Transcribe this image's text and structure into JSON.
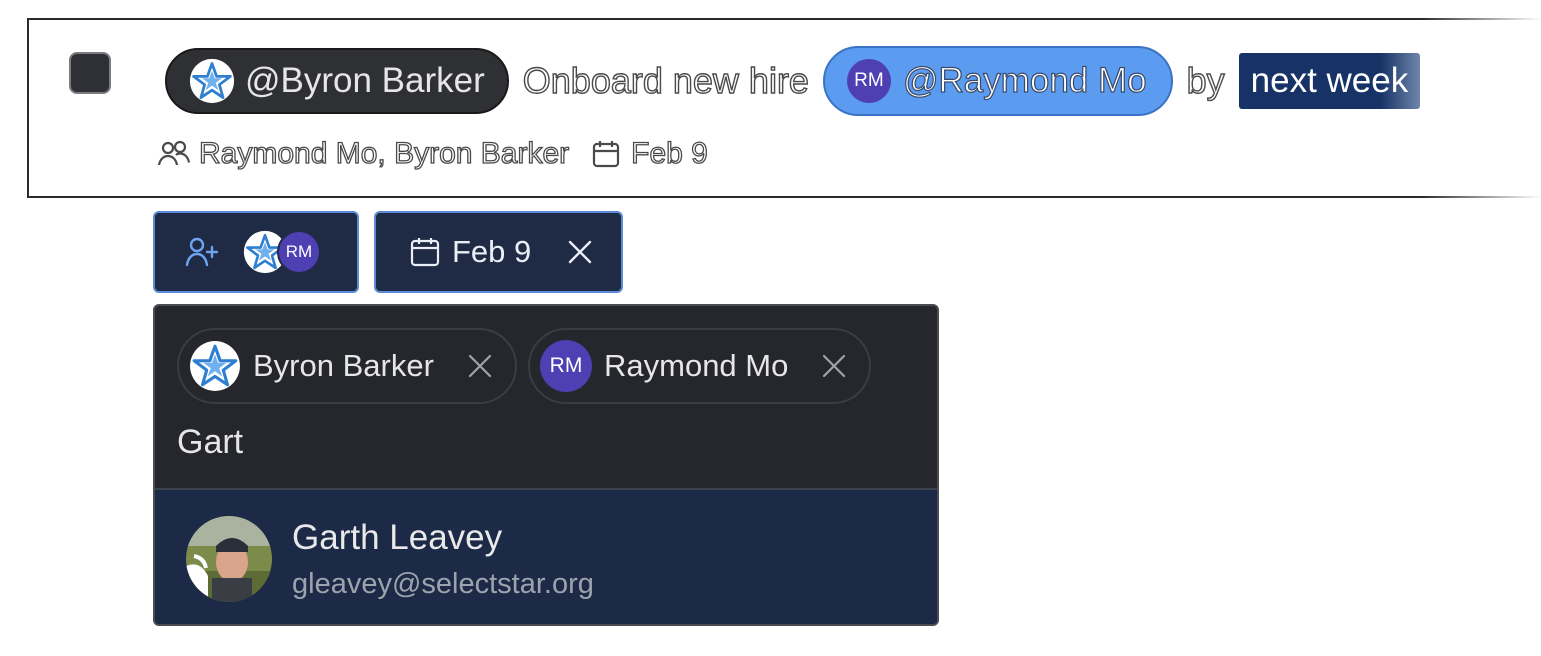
{
  "task": {
    "mention_1": "@Byron Barker",
    "text_1": "Onboard new hire",
    "mention_2": "@Raymond Mo",
    "mention_2_initials": "RM",
    "text_2": "by",
    "due_chip": "next week",
    "meta_assignees": "Raymond Mo, Byron Barker",
    "meta_date": "Feb 9"
  },
  "toolbar": {
    "assignee_initials": "RM",
    "date_label": "Feb 9"
  },
  "dropdown": {
    "selected": [
      {
        "name": "Byron Barker"
      },
      {
        "name": "Raymond Mo",
        "initials": "RM"
      }
    ],
    "search_value": "Gart",
    "result": {
      "name": "Garth Leavey",
      "email": "gleavey@selectstar.org"
    }
  },
  "colors": {
    "mention_blue": "#5b9bf0",
    "avatar_purple": "#4e3fb2",
    "dropdown_bg": "#25272c",
    "highlight_bg": "#1c2a47",
    "button_border": "#5d8ad6"
  },
  "icons": [
    "star-avatar-icon",
    "users-icon",
    "calendar-icon",
    "user-plus-icon",
    "close-icon"
  ]
}
